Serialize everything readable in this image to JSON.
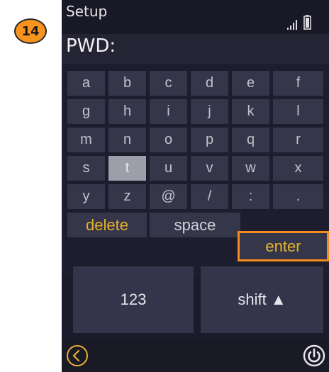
{
  "annotation": {
    "step": "14"
  },
  "status": {
    "title": "Setup",
    "signal_icon": "signal-bars-icon",
    "battery_icon": "battery-icon"
  },
  "password": {
    "label": "PWD:"
  },
  "keyboard": {
    "rows": [
      [
        "a",
        "b",
        "c",
        "d",
        "e",
        "f"
      ],
      [
        "g",
        "h",
        "i",
        "j",
        "k",
        "l"
      ],
      [
        "m",
        "n",
        "o",
        "p",
        "q",
        "r"
      ],
      [
        "s",
        "t",
        "u",
        "v",
        "w",
        "x"
      ],
      [
        "y",
        "z",
        "@",
        "/",
        ":",
        "."
      ]
    ],
    "selected_key": "t",
    "delete_label": "delete",
    "space_label": "space",
    "enter_label": "enter",
    "numbers_label": "123",
    "shift_label": "shift ▲"
  },
  "nav": {
    "back_icon": "back-chevron-icon",
    "power_icon": "power-icon"
  },
  "colors": {
    "accent": "#e6b22b",
    "highlight": "#f28c1c",
    "background": "#1c1b2b"
  }
}
